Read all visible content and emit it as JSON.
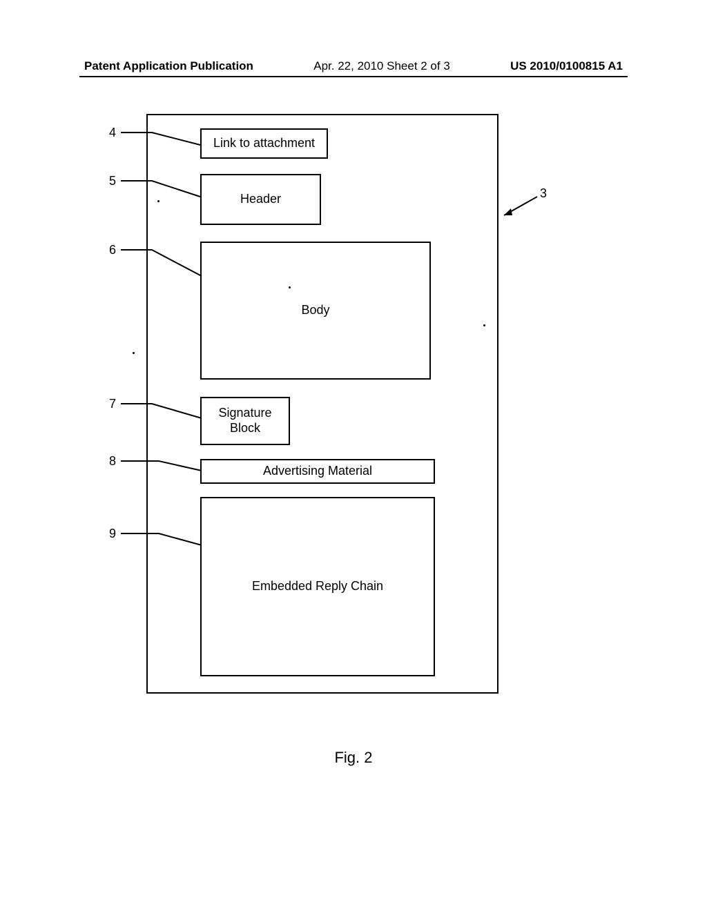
{
  "header": {
    "left": "Patent Application Publication",
    "center": "Apr. 22, 2010  Sheet 2 of 3",
    "right": "US 2010/0100815 A1"
  },
  "refs": {
    "r3": "3",
    "r4": "4",
    "r5": "5",
    "r6": "6",
    "r7": "7",
    "r8": "8",
    "r9": "9"
  },
  "boxes": {
    "link": "Link to attachment",
    "header": "Header",
    "body": "Body",
    "sig": "Signature Block",
    "advert": "Advertising Material",
    "reply": "Embedded Reply Chain"
  },
  "figure_label": "Fig. 2"
}
